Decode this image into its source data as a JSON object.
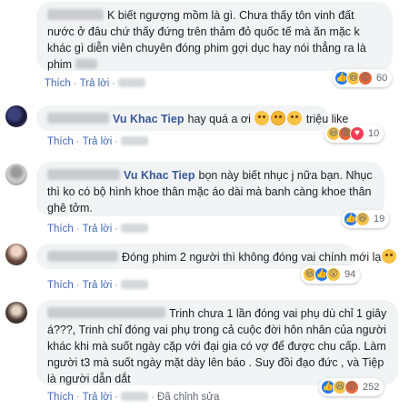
{
  "comments": [
    {
      "author_link": "",
      "text": "K biết ngượng mồm là gì. Chưa thấy tôn vinh đất nước ở đâu chứ thấy đứng trên thảm đỏ quốc tế mà ăn mặc k khác gì diễn viên chuyên đóng phim gợi dục hay nói thẳng ra là phim",
      "reactions": [
        "like",
        "haha",
        "angry"
      ],
      "count": "60",
      "actions": {
        "like": "Thích",
        "reply": "Trả lời"
      }
    },
    {
      "author_link": "Vu Khac Tiep",
      "text": "hay quá a ơi",
      "suffix": "triệu like",
      "reactions": [
        "haha",
        "angry",
        "love"
      ],
      "count": "10",
      "actions": {
        "like": "Thích",
        "reply": "Trả lời"
      }
    },
    {
      "author_link": "Vu Khac Tiep",
      "text": "bọn này biết nhục j nữa bạn. Nhục thì ko có bộ hình khoe thân mặc áo dài mà banh càng khoe thân ghê tởm.",
      "reactions": [
        "like",
        "haha"
      ],
      "count": "19",
      "actions": {
        "like": "Thích",
        "reply": "Trả lời"
      }
    },
    {
      "author_link": "",
      "text": "Đóng phim 2 người thì không đóng vai chính mới lạ",
      "reactions": [
        "haha",
        "like",
        "wow"
      ],
      "count": "94",
      "actions": {
        "like": "Thích",
        "reply": "Trả lời"
      }
    },
    {
      "author_link": "",
      "text": "Trinh chưa 1 lần đóng vai phụ dù chỉ 1 giây á???, Trinh chỉ đóng vai phụ trong cả cuộc đời hôn nhân của người khác khi mà suốt ngày cặp với đại gia có vợ để được chu cấp. Làm người t3 mà suốt ngày mặt dày lên báo . Suy đồi đạo đức , và Tiệp là người dẫn dắt",
      "reactions": [
        "like",
        "haha",
        "angry"
      ],
      "count": "252",
      "actions": {
        "like": "Thích",
        "reply": "Trả lời",
        "edited": "Đã chỉnh sửa"
      }
    }
  ],
  "icons": {
    "like": "thumbs-up-icon",
    "haha": "laughing-face-icon",
    "angry": "angry-face-icon",
    "love": "heart-icon",
    "wow": "wow-face-icon"
  },
  "colors": {
    "bubble": "#f2f3f5",
    "link": "#385898",
    "action": "#4267b2",
    "like": "#2078f4",
    "angry": "#e5663b",
    "haha": "#f7c344"
  }
}
